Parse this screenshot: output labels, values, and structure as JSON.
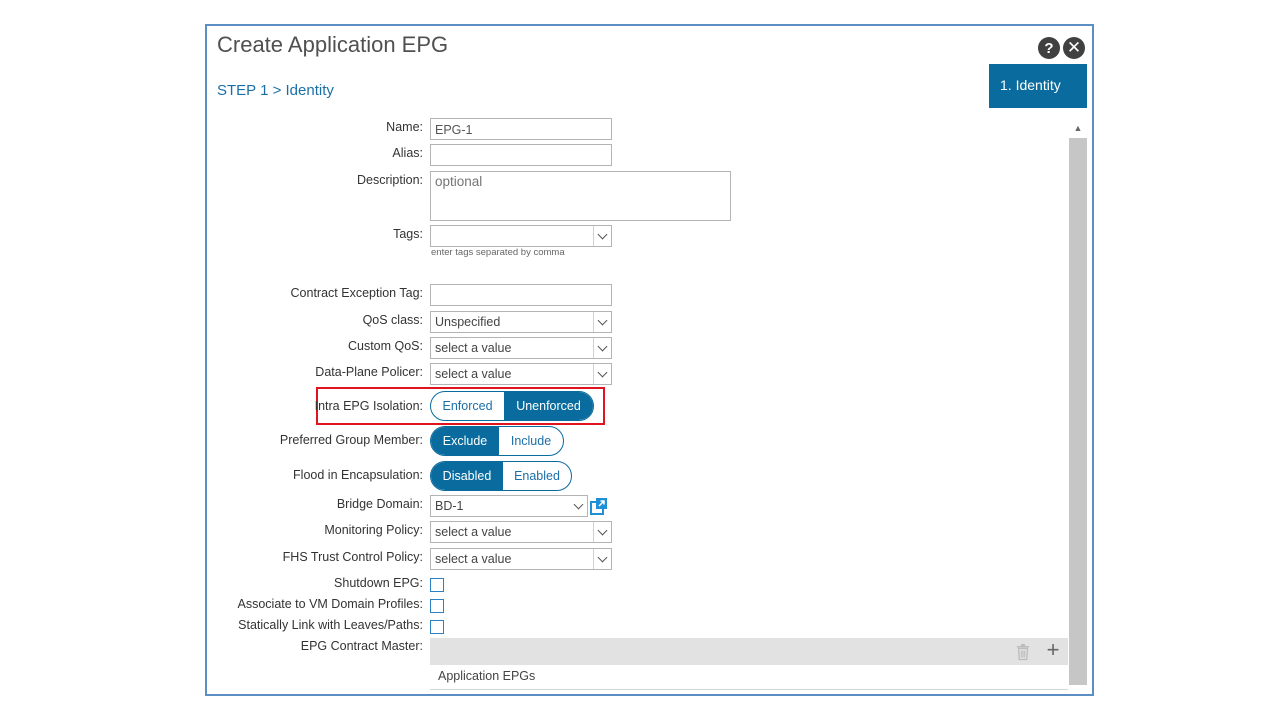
{
  "dialog": {
    "title": "Create Application EPG",
    "step_label": "STEP 1 > Identity",
    "step_tab": "1. Identity",
    "help_symbol": "?",
    "close_symbol": "✕"
  },
  "colors": {
    "accent": "#0a6c9e",
    "dialog_border": "#5b8ec5",
    "highlight_border": "#e0141e"
  },
  "form": {
    "name": {
      "label": "Name:",
      "value": "EPG-1"
    },
    "alias": {
      "label": "Alias:",
      "value": ""
    },
    "description": {
      "label": "Description:",
      "placeholder": "optional"
    },
    "tags": {
      "label": "Tags:",
      "hint": "enter tags separated by comma"
    },
    "contract_exception_tag": {
      "label": "Contract Exception Tag:",
      "value": ""
    },
    "qos_class": {
      "label": "QoS class:",
      "value": "Unspecified"
    },
    "custom_qos": {
      "label": "Custom QoS:",
      "value": "select a value"
    },
    "data_plane_policer": {
      "label": "Data-Plane Policer:",
      "value": "select a value"
    },
    "intra_epg_isolation": {
      "label": "Intra EPG Isolation:",
      "options": [
        "Enforced",
        "Unenforced"
      ],
      "selected": "Unenforced"
    },
    "preferred_group_member": {
      "label": "Preferred Group Member:",
      "options": [
        "Exclude",
        "Include"
      ],
      "selected": "Exclude"
    },
    "flood_in_encapsulation": {
      "label": "Flood in Encapsulation:",
      "options": [
        "Disabled",
        "Enabled"
      ],
      "selected": "Disabled"
    },
    "bridge_domain": {
      "label": "Bridge Domain:",
      "value": "BD-1"
    },
    "monitoring_policy": {
      "label": "Monitoring Policy:",
      "value": "select a value"
    },
    "fhs_trust_control_policy": {
      "label": "FHS Trust Control Policy:",
      "value": "select a value"
    },
    "shutdown_epg": {
      "label": "Shutdown EPG:",
      "checked": false
    },
    "associate_vm_domain": {
      "label": "Associate to VM Domain Profiles:",
      "checked": false
    },
    "statically_link": {
      "label": "Statically Link with Leaves/Paths:",
      "checked": false
    },
    "epg_contract_master": {
      "label": "EPG Contract Master:",
      "column_header": "Application EPGs"
    }
  },
  "icons": {
    "help": "help-icon",
    "close": "close-icon",
    "dropdown": "chevron-down-icon",
    "external_link": "external-link-icon",
    "trash": "trash-icon",
    "add": "plus-icon",
    "scroll_up": "scroll-up-icon"
  }
}
